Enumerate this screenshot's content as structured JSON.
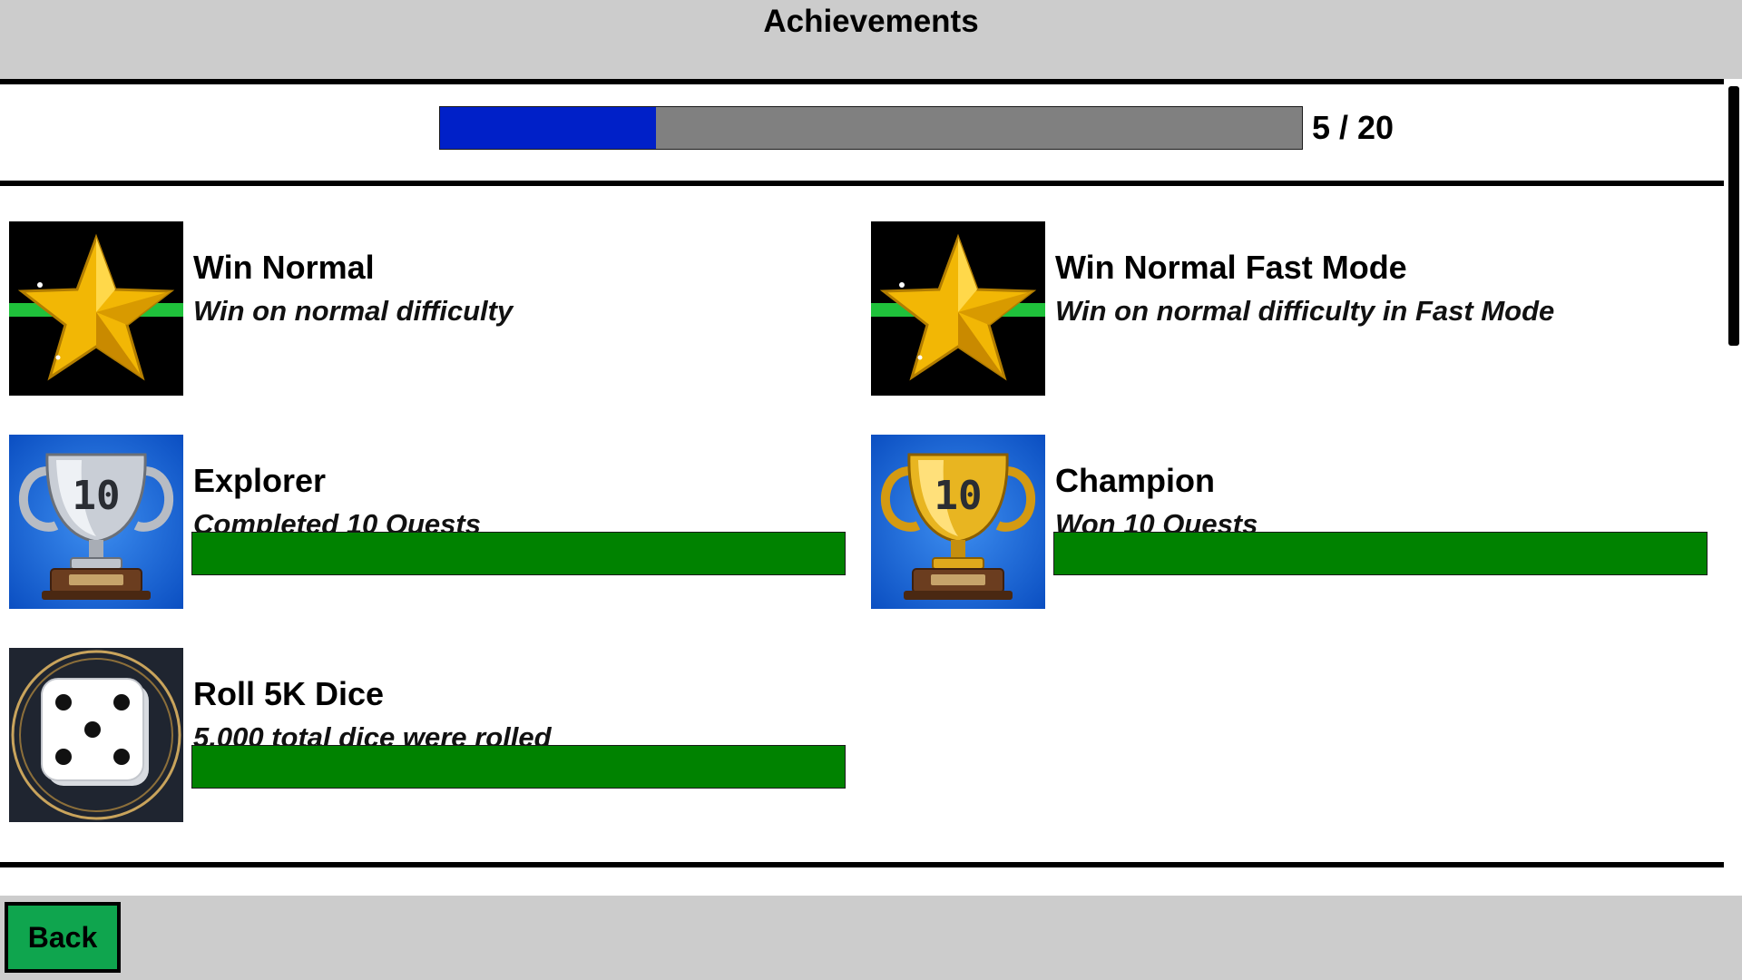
{
  "header": {
    "title": "Achievements"
  },
  "progress": {
    "fraction": 0.25,
    "label": "5 / 20"
  },
  "achievements": [
    {
      "name": "Win Normal",
      "description": "Win on normal difficulty",
      "icon": "star-icon"
    },
    {
      "name": "Win Normal Fast Mode",
      "description": "Win on normal difficulty in Fast Mode",
      "icon": "star-icon"
    },
    {
      "name": "Explorer",
      "description": "Completed 10 Quests",
      "icon": "silver-trophy-icon",
      "progress": 1.0
    },
    {
      "name": "Champion",
      "description": "Won 10 Quests",
      "icon": "gold-trophy-icon",
      "progress": 1.0
    },
    {
      "name": "Roll 5K Dice",
      "description": "5,000 total dice were rolled",
      "icon": "dice-icon",
      "progress": 1.0
    }
  ],
  "trophy_number": "10",
  "footer": {
    "back_label": "Back"
  },
  "colors": {
    "progress_fill": "#0020c8",
    "progress_track": "#808080",
    "achievement_bar": "#008200",
    "back_button": "#0fa54e",
    "chrome": "#cccccc"
  }
}
